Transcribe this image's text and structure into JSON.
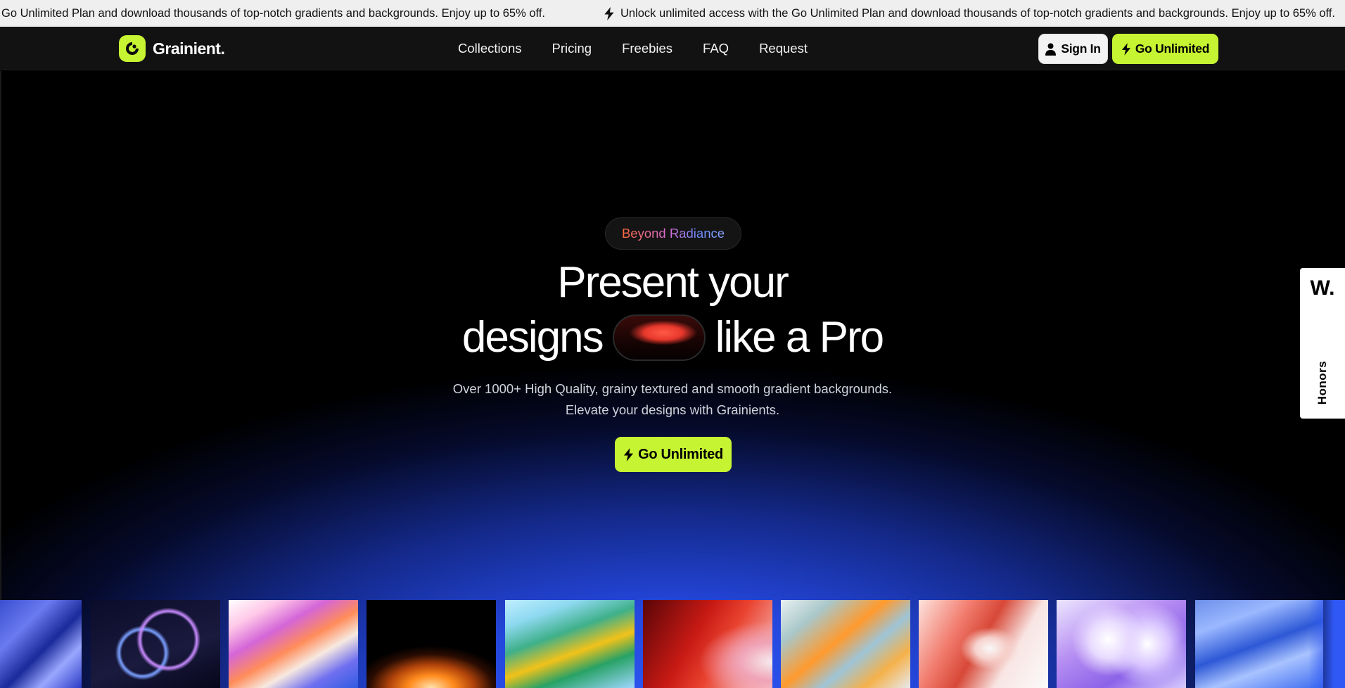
{
  "announcement": {
    "text_partial": "Go Unlimited Plan and download thousands of top-notch gradients and backgrounds. Enjoy up to 65% off.",
    "text_full": "Unlock unlimited access with the Go Unlimited Plan and download thousands of top-notch gradients and backgrounds. Enjoy up to 65% off.",
    "icon": "bolt-icon"
  },
  "nav": {
    "logo_text": "Grainient.",
    "links": [
      "Collections",
      "Pricing",
      "Freebies",
      "FAQ",
      "Request"
    ],
    "signin_label": "Sign In",
    "cta_label": "Go Unlimited"
  },
  "hero": {
    "badge": "Beyond Radiance",
    "headline_line1": "Present your",
    "headline_line2_a": "designs",
    "headline_line2_b": "like a Pro",
    "sub_line1": "Over 1000+ High Quality, grainy textured and smooth gradient backgrounds.",
    "sub_line2": "Elevate your designs with Grainients.",
    "cta_label": "Go Unlimited"
  },
  "honors": {
    "mark": "W.",
    "label": "Honors"
  },
  "colors": {
    "accent": "#c6f432",
    "hero_blue": "#2f58f4",
    "nav_bg": "#121212",
    "bar_bg": "#efefef"
  },
  "thumbnails": [
    "gradient-thumbnail-blue-glass",
    "gradient-thumbnail-rings",
    "gradient-thumbnail-pink-wave",
    "gradient-thumbnail-orange-glow",
    "gradient-thumbnail-green-yellow",
    "gradient-thumbnail-red-white",
    "gradient-thumbnail-orange-glass",
    "gradient-thumbnail-coral",
    "gradient-thumbnail-lavender-drops",
    "gradient-thumbnail-blue-wave"
  ]
}
